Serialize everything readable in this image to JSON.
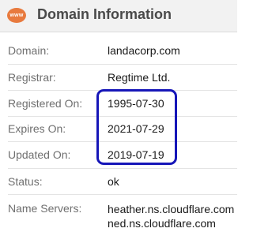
{
  "header": {
    "logo_text": "www",
    "title": "Domain Information"
  },
  "rows": [
    {
      "label": "Domain:",
      "value": "landacorp.com"
    },
    {
      "label": "Registrar:",
      "value": "Regtime Ltd."
    },
    {
      "label": "Registered On:",
      "value": "1995-07-30"
    },
    {
      "label": "Expires On:",
      "value": "2021-07-29"
    },
    {
      "label": "Updated On:",
      "value": "2019-07-19"
    },
    {
      "label": "Status:",
      "value": "ok"
    },
    {
      "label": "Name Servers:",
      "values": [
        "heather.ns.cloudflare.com",
        "ned.ns.cloudflare.com"
      ]
    }
  ],
  "colors": {
    "highlight": "#1616b8",
    "logo": "#e87a3e"
  }
}
